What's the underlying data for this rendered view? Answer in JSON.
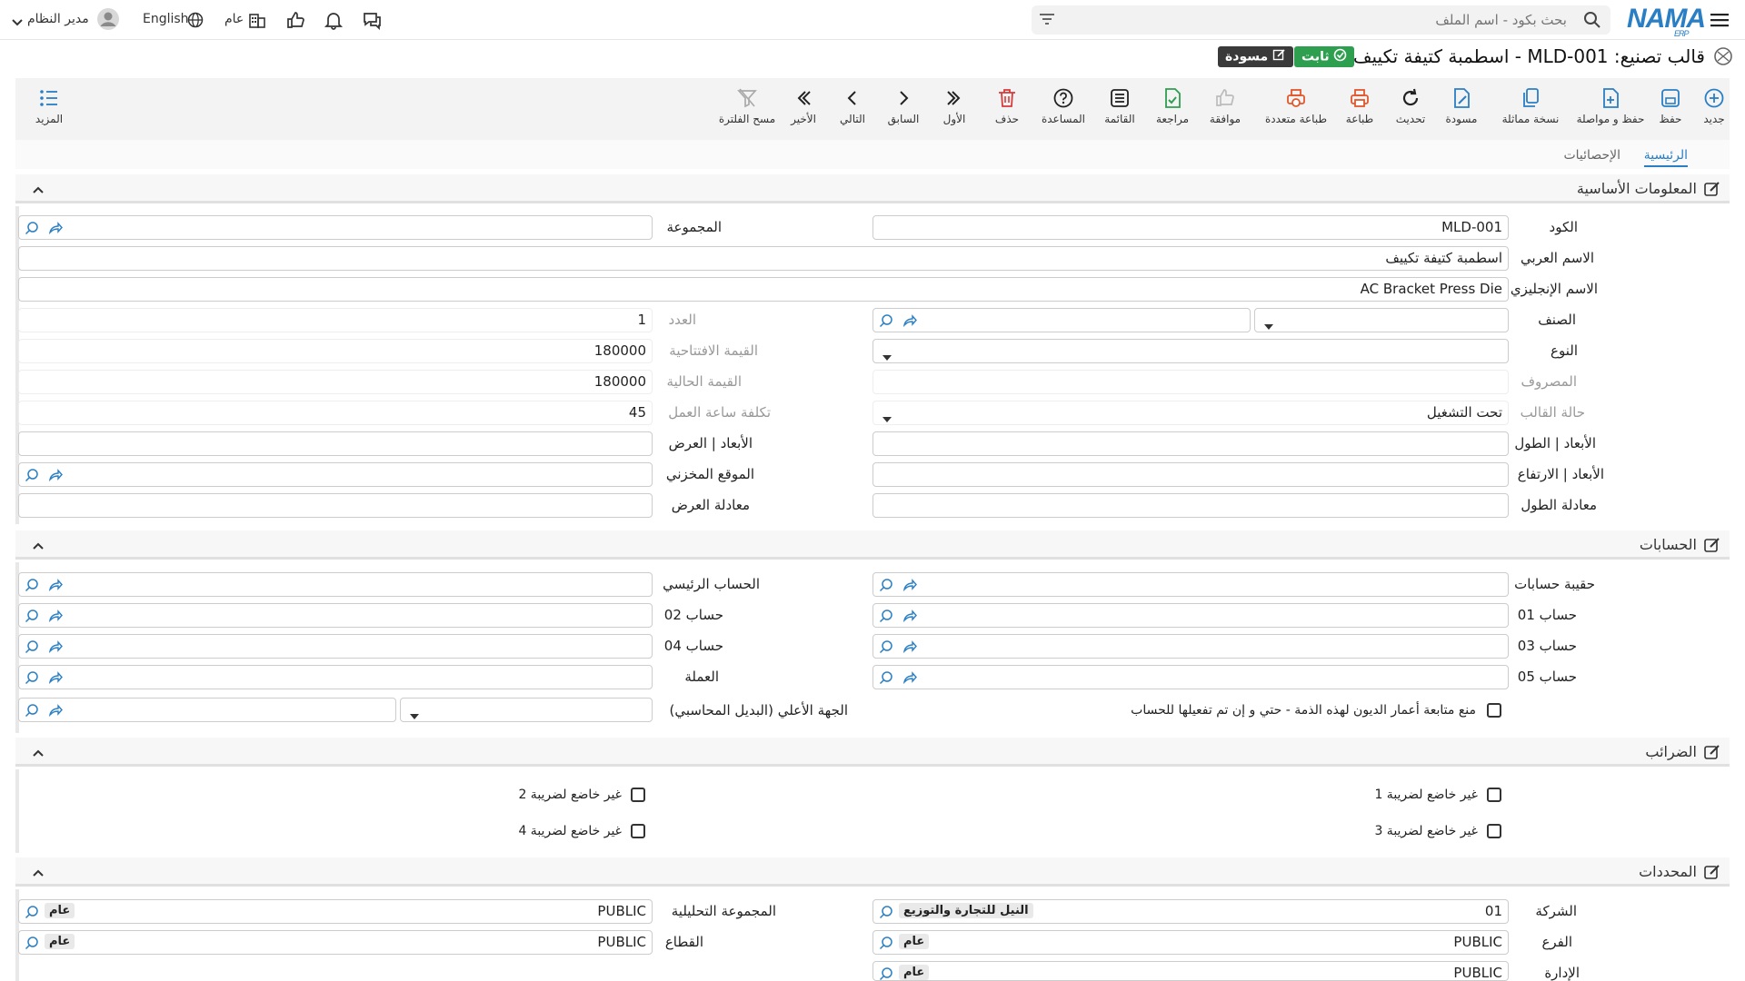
{
  "header": {
    "logo": "NAMA",
    "logo_sub": "ERP",
    "search_placeholder": "بحث بكود - اسم الملف",
    "user": "مدير النظام",
    "lang": "English",
    "scope": "عام"
  },
  "page": {
    "title": "قالب تصنيع: MLD-001 - اسطمبة كتيفة تكييف",
    "badge_fixed": "ثابت",
    "badge_draft": "مسودة"
  },
  "toolbar": {
    "new": "جديد",
    "save": "حفظ",
    "save_continue": "حفظ و مواصلة",
    "copy": "نسخة مماثلة",
    "draft": "مسودة",
    "refresh": "تحديث",
    "print": "طباعة",
    "multi_print": "طباعة متعددة",
    "approve": "موافقة",
    "review": "مراجعة",
    "list": "القائمة",
    "help": "المساعدة",
    "delete": "حذف",
    "first": "الأول",
    "prev": "السابق",
    "next": "التالي",
    "last": "الأخير",
    "clear_filter": "مسح الفلترة",
    "more": "المزيد"
  },
  "tabs": {
    "main": "الرئيسية",
    "stats": "الإحصائيات"
  },
  "basic": {
    "title": "المعلومات الأساسية",
    "code_label": "الكود",
    "code": "MLD-001",
    "group_label": "المجموعة",
    "ar_name_label": "الاسم العربي",
    "ar_name": "اسطمبة كتيفة تكييف",
    "en_name_label": "الاسم الإنجليزي",
    "en_name": "AC Bracket Press Die",
    "class_label": "الصنف",
    "count_label": "العدد",
    "count": "1",
    "type_label": "النوع",
    "opening_label": "القيمة الافتتاحية",
    "opening": "180000",
    "expense_label": "المصروف",
    "current_label": "القيمة الحالية",
    "current": "180000",
    "status_label": "حالة القالب",
    "status": "تحت التشغيل",
    "labor_label": "تكلفة ساعة العمل",
    "labor": "45",
    "length_label": "الأبعاد | الطول",
    "width_label": "الأبعاد | العرض",
    "height_label": "الأبعاد | الارتفاع",
    "location_label": "الموقع المخزني",
    "len_eq_label": "معادلة الطول",
    "wid_eq_label": "معادلة العرض"
  },
  "accounts": {
    "title": "الحسابات",
    "bag_label": "حقيبة حسابات",
    "main_label": "الحساب الرئيسي",
    "acc01_label": "حساب 01",
    "acc02_label": "حساب 02",
    "acc03_label": "حساب 03",
    "acc04_label": "حساب 04",
    "acc05_label": "حساب 05",
    "currency_label": "العملة",
    "prevent_label": "منع متابعة أعمار الديون لهذه الذمة - حتي و إن تم تفعيلها للحساب",
    "parent_label": "الجهة الأعلي (البديل المحاسبي)"
  },
  "taxes": {
    "title": "الضرائب",
    "t1": "غير خاضع لضريبة 1",
    "t2": "غير خاضع لضريبة 2",
    "t3": "غير خاضع لضريبة 3",
    "t4": "غير خاضع لضريبة 4"
  },
  "dims": {
    "title": "المحددات",
    "company_label": "الشركة",
    "company_code": "01",
    "company_tag": "النيل للتجارة والتوزيع",
    "analytic_label": "المجموعة التحليلية",
    "analytic_code": "PUBLIC",
    "analytic_tag": "عام",
    "branch_label": "الفرع",
    "branch_code": "PUBLIC",
    "branch_tag": "عام",
    "sector_label": "القطاع",
    "sector_code": "PUBLIC",
    "sector_tag": "عام",
    "admin_label": "الإدارة",
    "admin_code": "PUBLIC",
    "admin_tag": "عام"
  },
  "colors": {
    "accent": "#2a7fc4",
    "fixed_badge": "#2e9e4f",
    "draft_badge": "#3a3a3a"
  }
}
